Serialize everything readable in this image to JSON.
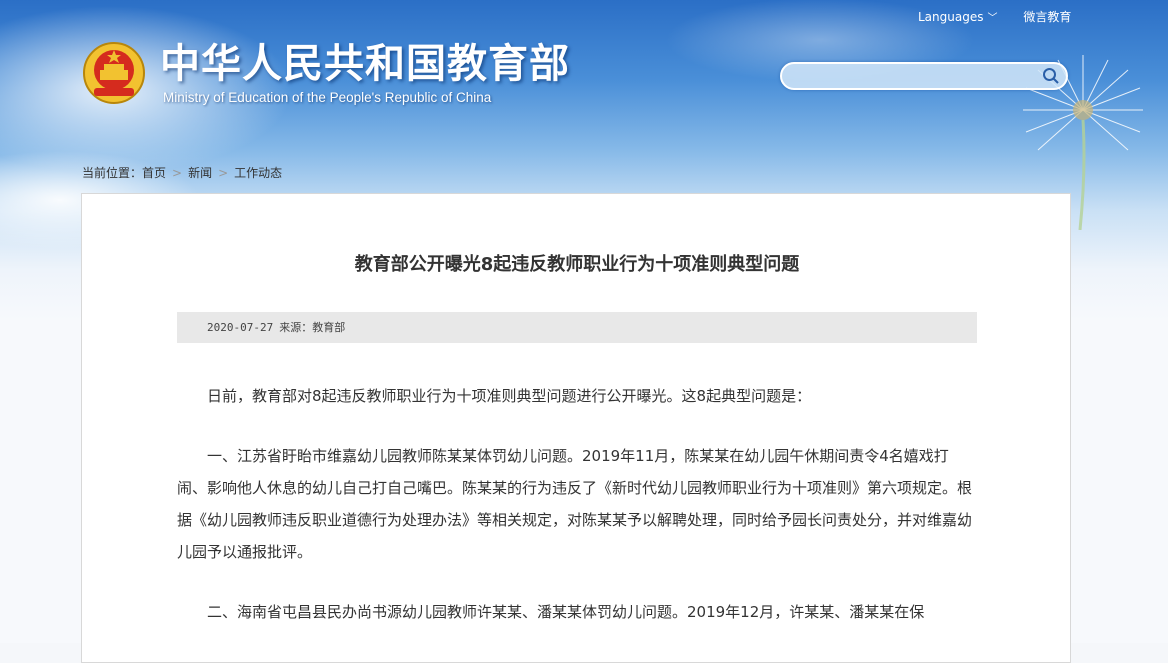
{
  "header": {
    "cn_title": "中华人民共和国教育部",
    "en_title": "Ministry of Education of the People's Republic of China",
    "languages_label": "Languages",
    "weibo_label": "微言教育"
  },
  "search": {
    "placeholder": ""
  },
  "breadcrumb": {
    "prefix": "当前位置：",
    "items": [
      "首页",
      "新闻",
      "工作动态"
    ]
  },
  "article": {
    "title": "教育部公开曝光8起违反教师职业行为十项准则典型问题",
    "date": "2020-07-27",
    "source": "来源：教育部",
    "paragraphs": [
      "日前，教育部对8起违反教师职业行为十项准则典型问题进行公开曝光。这8起典型问题是：",
      "一、江苏省盱眙市维嘉幼儿园教师陈某某体罚幼儿问题。2019年11月，陈某某在幼儿园午休期间责令4名嬉戏打闹、影响他人休息的幼儿自己打自己嘴巴。陈某某的行为违反了《新时代幼儿园教师职业行为十项准则》第六项规定。根据《幼儿园教师违反职业道德行为处理办法》等相关规定，对陈某某予以解聘处理，同时给予园长问责处分，并对维嘉幼儿园予以通报批评。",
      "二、海南省屯昌县民办尚书源幼儿园教师许某某、潘某某体罚幼儿问题。2019年12月，许某某、潘某某在保"
    ]
  },
  "colors": {
    "sky_top": "#2b6fc6",
    "panel_bg": "#ffffff",
    "meta_bg": "#e8e8e8",
    "text": "#333333"
  }
}
